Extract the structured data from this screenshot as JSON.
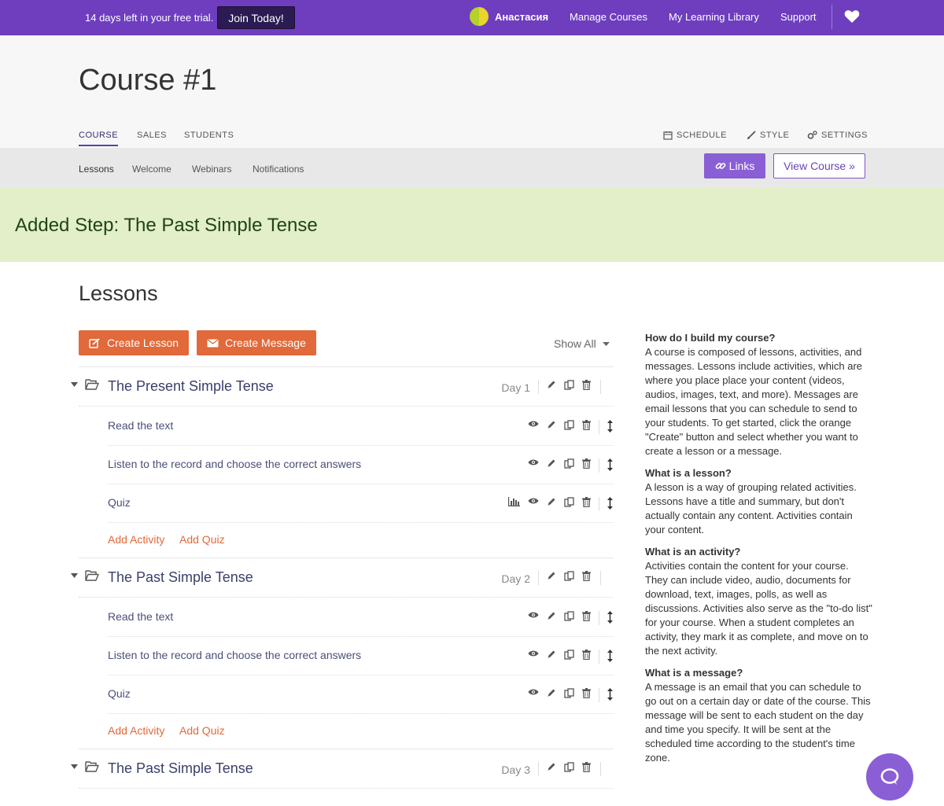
{
  "topbar": {
    "trial_text": "14 days left in your free trial.",
    "join_label": "Join Today!",
    "user_name": "Анастасия",
    "nav": [
      "Manage Courses",
      "My Learning Library",
      "Support"
    ],
    "color": "#6e3ebf"
  },
  "header": {
    "title": "Course #1",
    "tabs": [
      "COURSE",
      "SALES",
      "STUDENTS"
    ],
    "right_tabs": [
      "SCHEDULE",
      "STYLE",
      "SETTINGS"
    ]
  },
  "subnav": {
    "links": [
      "Lessons",
      "Welcome",
      "Webinars",
      "Notifications"
    ],
    "links_button": "Links",
    "view_course_button": "View Course »"
  },
  "flash": {
    "message": "Added Step: The Past Simple Tense"
  },
  "lessons": {
    "section_title": "Lessons",
    "create_lesson": "Create Lesson",
    "create_message": "Create Message",
    "show_all": "Show All",
    "add_activity": "Add Activity",
    "add_quiz": "Add Quiz",
    "items": [
      {
        "title": "The Present Simple Tense",
        "day": "Day 1",
        "activities": [
          "Read the text",
          "Listen to the record and choose the correct answers",
          "Quiz"
        ]
      },
      {
        "title": "The Past Simple Tense",
        "day": "Day 2",
        "activities": [
          "Read the text",
          "Listen to the record and choose the correct answers",
          "Quiz"
        ]
      },
      {
        "title": "The Past Simple Tense",
        "day": "Day 3",
        "activities": []
      }
    ]
  },
  "help": {
    "q1": "How do I build my course?",
    "a1": "A course is composed of lessons, activities, and messages. Lessons include activities, which are where you place place your content (videos, audios, images, text, and more). Messages are email lessons that you can schedule to send to your students. To get started, click the orange \"Create\" button and select whether you want to create a lesson or a message.",
    "q2": "What is a lesson?",
    "a2": "A lesson is a way of grouping related activities. Lessons have a title and summary, but don't actually contain any content. Activities contain your content.",
    "q3": "What is an activity?",
    "a3": "Activities contain the content for your course. They can include video, audio, documents for download, text, images, polls, as well as discussions. Activities also serve as the \"to-do list\" for your course. When a student completes an activity, they mark it as complete, and move on to the next activity.",
    "q4": "What is a message?",
    "a4": "A message is an email that you can schedule to go out on a certain day or date of the course. This message will be sent to each student on the day and time you specify. It will be sent at the scheduled time according to the student's time zone."
  },
  "colors": {
    "accent_orange": "#e1693a",
    "accent_purple": "#8a5fd6",
    "flash_bg": "#e2efc8"
  }
}
